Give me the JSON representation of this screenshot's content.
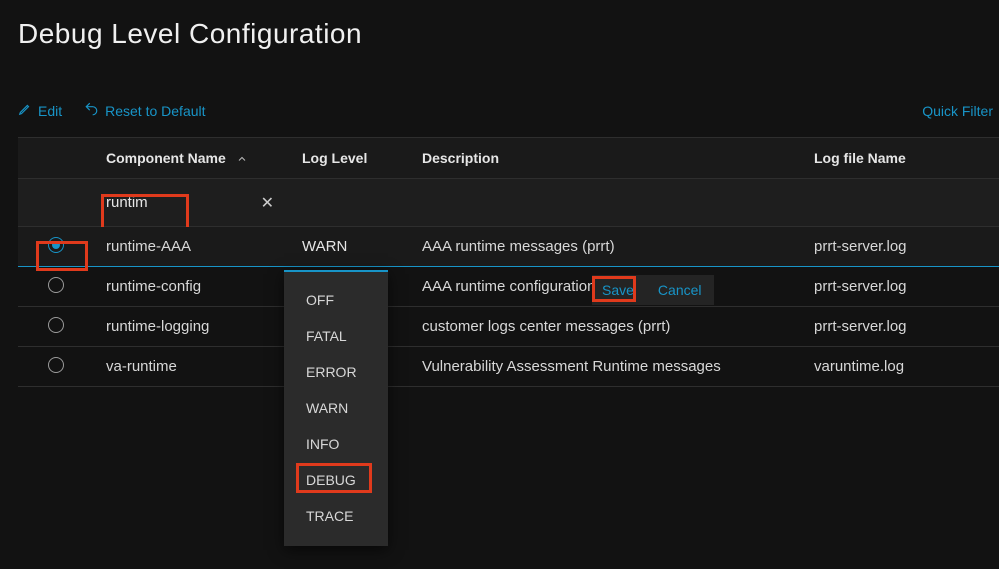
{
  "page_title": "Debug Level Configuration",
  "toolbar": {
    "edit_label": "Edit",
    "reset_label": "Reset to Default",
    "quick_filter_label": "Quick Filter"
  },
  "columns": {
    "component": "Component Name",
    "loglevel": "Log Level",
    "description": "Description",
    "logfile": "Log file Name"
  },
  "filter": {
    "component_value": "runtim",
    "clear_glyph": "✕"
  },
  "rows": [
    {
      "selected": true,
      "component": "runtime-AAA",
      "loglevel": "WARN",
      "description": "AAA runtime messages (prrt)",
      "logfile": "prrt-server.log"
    },
    {
      "selected": false,
      "component": "runtime-config",
      "loglevel": "",
      "description": "AAA runtime configuration",
      "logfile": "prrt-server.log"
    },
    {
      "selected": false,
      "component": "runtime-logging",
      "loglevel": "",
      "description": "customer logs center messages (prrt)",
      "logfile": "prrt-server.log"
    },
    {
      "selected": false,
      "component": "va-runtime",
      "loglevel": "",
      "description": "Vulnerability Assessment Runtime messages",
      "logfile": "varuntime.log"
    }
  ],
  "dropdown": {
    "options": [
      "OFF",
      "FATAL",
      "ERROR",
      "WARN",
      "INFO",
      "DEBUG",
      "TRACE"
    ],
    "highlighted": "DEBUG"
  },
  "actions": {
    "save_label": "Save",
    "cancel_label": "Cancel"
  },
  "highlight_color": "#e03a1c",
  "accent_color": "#1894c7"
}
